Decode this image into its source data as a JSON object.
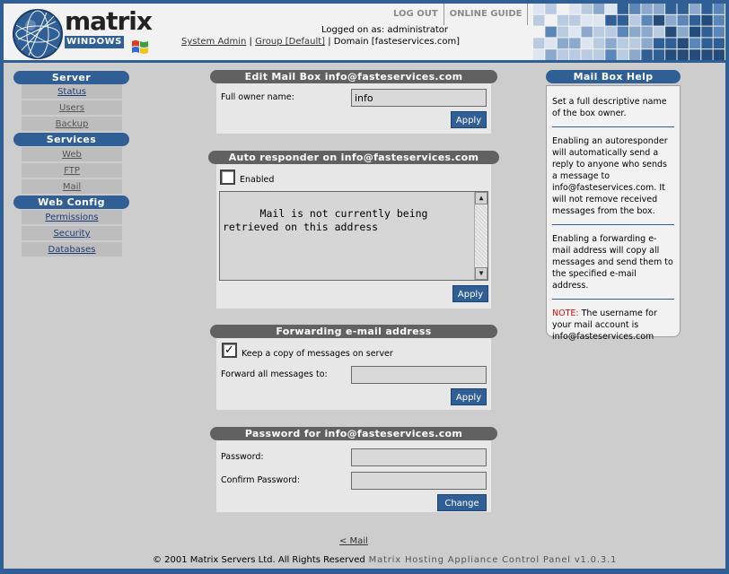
{
  "header": {
    "brand_top": "matrix",
    "brand_bottom": "WINDOWS",
    "nav": [
      "LOG OUT",
      "ONLINE GUIDE"
    ],
    "logged_in": "Logged on as: administrator",
    "crumb_system": "System Admin",
    "crumb_sep": "|",
    "crumb_group": "Group [Default]",
    "crumb_domain": "| Domain [fasteservices.com]"
  },
  "sidebar": {
    "server_title": "Server",
    "server_items": [
      "Status",
      "Users",
      "Backup"
    ],
    "services_title": "Services",
    "services_items": [
      "Web",
      "FTP",
      "Mail"
    ],
    "webconfig_title": "Web Config",
    "webconfig_items": [
      "Permissions",
      "Security",
      "Databases"
    ]
  },
  "edit_mailbox": {
    "title": "Edit Mail Box info@fasteservices.com",
    "owner_label": "Full owner name:",
    "owner_value": "info",
    "apply": "Apply"
  },
  "autoresponder": {
    "title": "Auto responder on info@fasteservices.com",
    "enabled_label": "Enabled",
    "enabled": false,
    "message": "Mail is not currently being\nretrieved on this address",
    "apply": "Apply"
  },
  "forwarding": {
    "title": "Forwarding e-mail address",
    "keep_copy_label": "Keep a copy of messages on server",
    "keep_copy": true,
    "forward_label": "Forward all messages to:",
    "forward_value": "",
    "apply": "Apply"
  },
  "password": {
    "title": "Password for info@fasteservices.com",
    "password_label": "Password:",
    "confirm_label": "Confirm Password:",
    "change": "Change"
  },
  "help": {
    "title": "Mail Box Help",
    "p1": "Set a full descriptive name of the box owner.",
    "p2": "Enabling an autoresponder will automatically send a reply to anyone who sends a message to info@fasteservices.com. It will not remove received messages from the box.",
    "p3": "Enabling a forwarding e-mail address will copy all messages and send them to the specified e-mail address.",
    "note_keyword": "NOTE:",
    "note_text": " The username for your mail account is info@fasteservices.com"
  },
  "footer": {
    "back_link": "< Mail",
    "copyright": "© 2001 Matrix Servers Ltd. All Rights Reserved",
    "version": " Matrix Hosting Appliance Control Panel v1.0.3.1"
  },
  "colors": {
    "brand_blue": "#2f5f95",
    "panel_title_gray": "#616161",
    "note_red": "#cc1111"
  },
  "icons": [
    "globe-logo-icon",
    "windows-flag-icon",
    "checkbox-check-icon",
    "scroll-up-arrow-icon",
    "scroll-down-arrow-icon"
  ]
}
